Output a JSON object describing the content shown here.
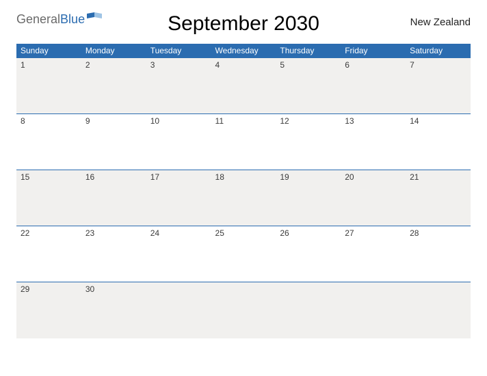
{
  "logo": {
    "gen": "General",
    "blue": "Blue"
  },
  "title": "September 2030",
  "region": "New Zealand",
  "columns": [
    "Sunday",
    "Monday",
    "Tuesday",
    "Wednesday",
    "Thursday",
    "Friday",
    "Saturday"
  ],
  "weeks": [
    [
      "1",
      "2",
      "3",
      "4",
      "5",
      "6",
      "7"
    ],
    [
      "8",
      "9",
      "10",
      "11",
      "12",
      "13",
      "14"
    ],
    [
      "15",
      "16",
      "17",
      "18",
      "19",
      "20",
      "21"
    ],
    [
      "22",
      "23",
      "24",
      "25",
      "26",
      "27",
      "28"
    ],
    [
      "29",
      "30",
      "",
      "",
      "",
      "",
      ""
    ]
  ]
}
